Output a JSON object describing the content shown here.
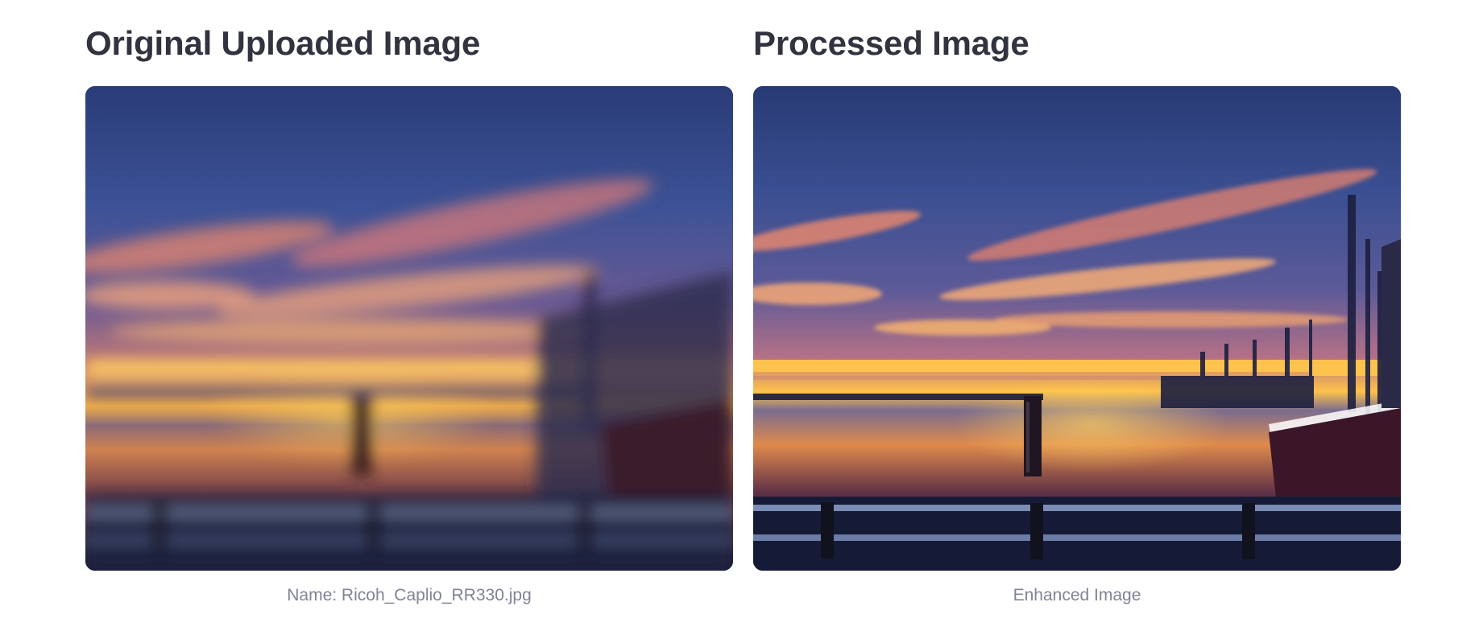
{
  "columns": {
    "original": {
      "title": "Original Uploaded Image",
      "caption": "Name: Ricoh_Caplio_RR330.jpg"
    },
    "processed": {
      "title": "Processed Image",
      "caption": "Enhanced Image"
    }
  },
  "colors": {
    "heading": "#31333f",
    "caption": "#808495",
    "background": "#ffffff"
  }
}
